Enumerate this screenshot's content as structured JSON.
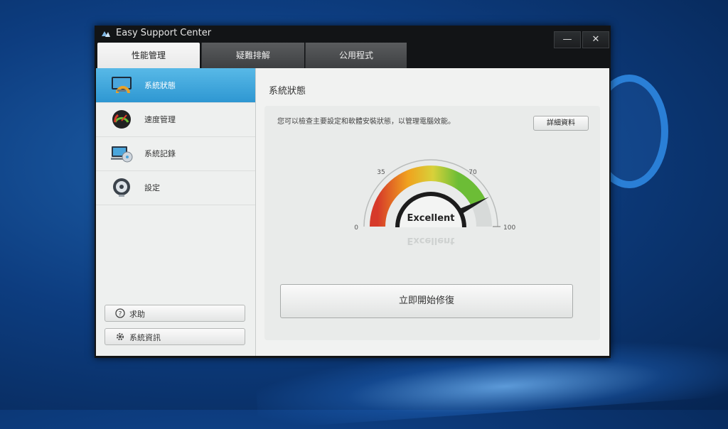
{
  "window": {
    "title": "Easy Support Center",
    "minimize_glyph": "—",
    "close_glyph": "✕"
  },
  "tabs": [
    {
      "label": "性能管理",
      "active": true
    },
    {
      "label": "疑難排解",
      "active": false
    },
    {
      "label": "公用程式",
      "active": false
    }
  ],
  "sidebar": {
    "items": [
      {
        "label": "系統狀態",
        "icon": "system-status-icon",
        "active": true
      },
      {
        "label": "速度管理",
        "icon": "speed-gauge-icon",
        "active": false
      },
      {
        "label": "系統記錄",
        "icon": "system-log-icon",
        "active": false
      },
      {
        "label": "設定",
        "icon": "settings-disc-icon",
        "active": false
      }
    ],
    "help_label": "求助",
    "sysinfo_label": "系統資訊"
  },
  "main": {
    "title": "系統狀態",
    "description": "您可以檢查主要設定和軟體安裝狀態，以管理電腦效能。",
    "details_label": "詳細資料",
    "repair_label": "立即開始修復"
  },
  "gauge": {
    "status_text": "Excellent",
    "value": 85,
    "min": 0,
    "max": 100,
    "tick_labels": {
      "t0": "0",
      "t35": "35",
      "t70": "70",
      "t100": "100"
    },
    "colors": {
      "red": "#d63a2a",
      "orange": "#f0a21e",
      "yellow": "#d8d13a",
      "green": "#6cbd36"
    }
  },
  "accent_color": "#2e97d2"
}
